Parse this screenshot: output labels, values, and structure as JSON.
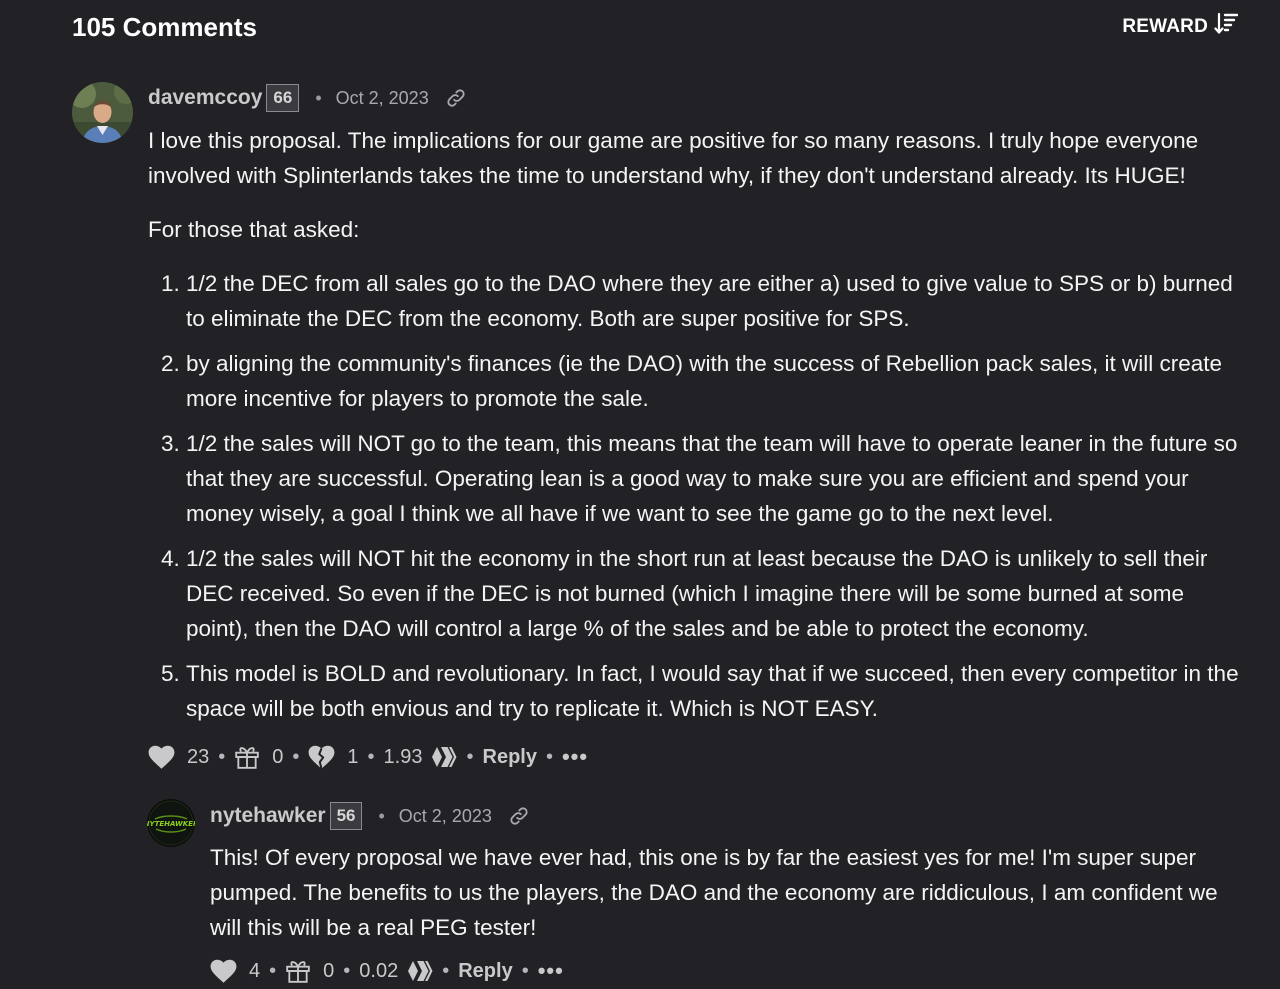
{
  "header": {
    "comments_count": "105 Comments",
    "reward_label": "REWARD",
    "sort_icon": "sort-descending-icon"
  },
  "comments": [
    {
      "username": "davemccoy",
      "reputation": "66",
      "date": "Oct 2, 2023",
      "paragraphs": [
        "I love this proposal. The implications for our game are positive for so many reasons. I truly hope everyone involved with Splinterlands takes the time to understand why, if they don't understand already. Its HUGE!",
        "For those that asked:"
      ],
      "list_items": [
        "1/2 the DEC from all sales go to the DAO where they are either a) used to give value to SPS or b) burned to eliminate the DEC from the economy. Both are super positive for SPS.",
        "by aligning the community's finances (ie the DAO) with the success of Rebellion pack sales, it will create more incentive for players to promote the sale.",
        "1/2 the sales will NOT go to the team, this means that the team will have to operate leaner in the future so that they are successful. Operating lean is a good way to make sure you are efficient and spend your money wisely, a goal I think we all have if we want to see the game go to the next level.",
        "1/2 the sales will NOT hit the economy in the short run at least because the DAO is unlikely to sell their DEC received. So even if the DEC is not burned (which I imagine there will be some burned at some point), then the DAO will control a large % of the sales and be able to protect the economy.",
        "This model is BOLD and revolutionary. In fact, I would say that if we succeed, then every competitor in the space will be both envious and try to replicate it. Which is NOT EASY."
      ],
      "likes": "23",
      "gifts": "0",
      "dislikes": "1",
      "payout": "1.93",
      "reply_label": "Reply",
      "more_label": "•••"
    },
    {
      "username": "nytehawker",
      "reputation": "56",
      "date": "Oct 2, 2023",
      "avatar_text": "NYTEHAWKER",
      "paragraphs": [
        "This! Of every proposal we have ever had, this one is by far the easiest yes for me! I'm super super pumped. The benefits to us the players, the DAO and the economy are riddiculous, I am confident we will this will be a real PEG tester!"
      ],
      "likes": "4",
      "gifts": "0",
      "payout": "0.02",
      "reply_label": "Reply",
      "more_label": "•••"
    }
  ],
  "separator": "•",
  "colors": {
    "background": "#222226",
    "text": "#f4f4f4",
    "muted": "#a8a8ae",
    "avatar_green": "#8fd11a"
  }
}
